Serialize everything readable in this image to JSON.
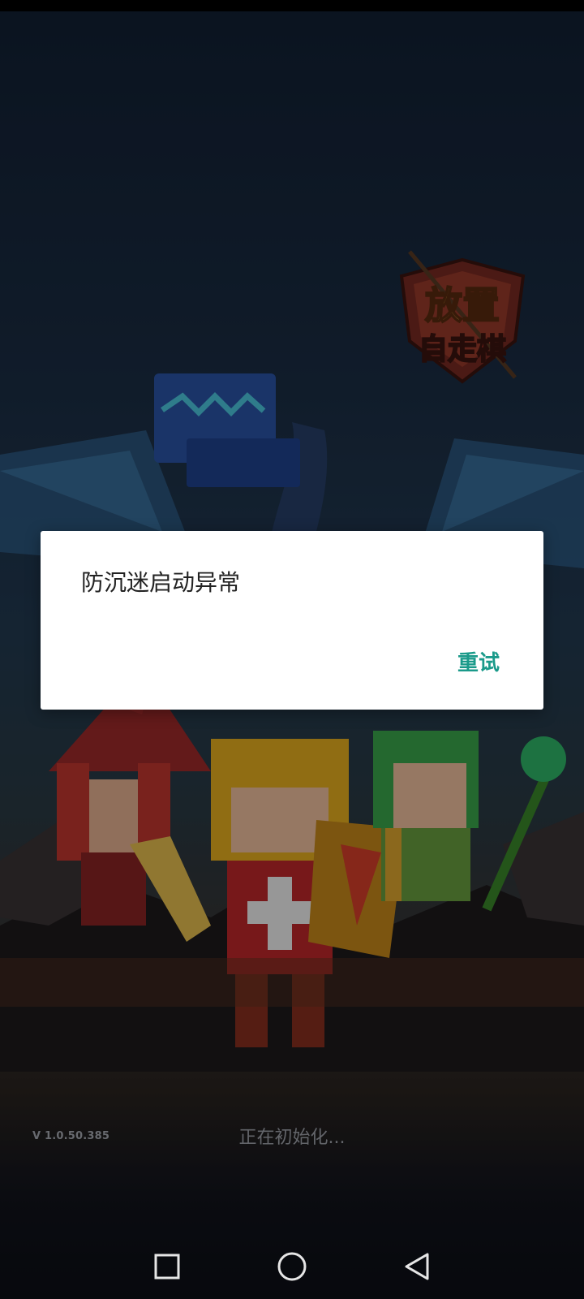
{
  "app": {
    "logo_text_line1": "放置",
    "logo_text_line2": "自走棋",
    "version": "V 1.0.50.385",
    "loading_text": "正在初始化..."
  },
  "dialog": {
    "message": "防沉迷启动异常",
    "button_label": "重试",
    "accent_color": "#1a9a8a"
  },
  "nav": {
    "recents_icon": "square-icon",
    "home_icon": "circle-icon",
    "back_icon": "triangle-back-icon"
  }
}
